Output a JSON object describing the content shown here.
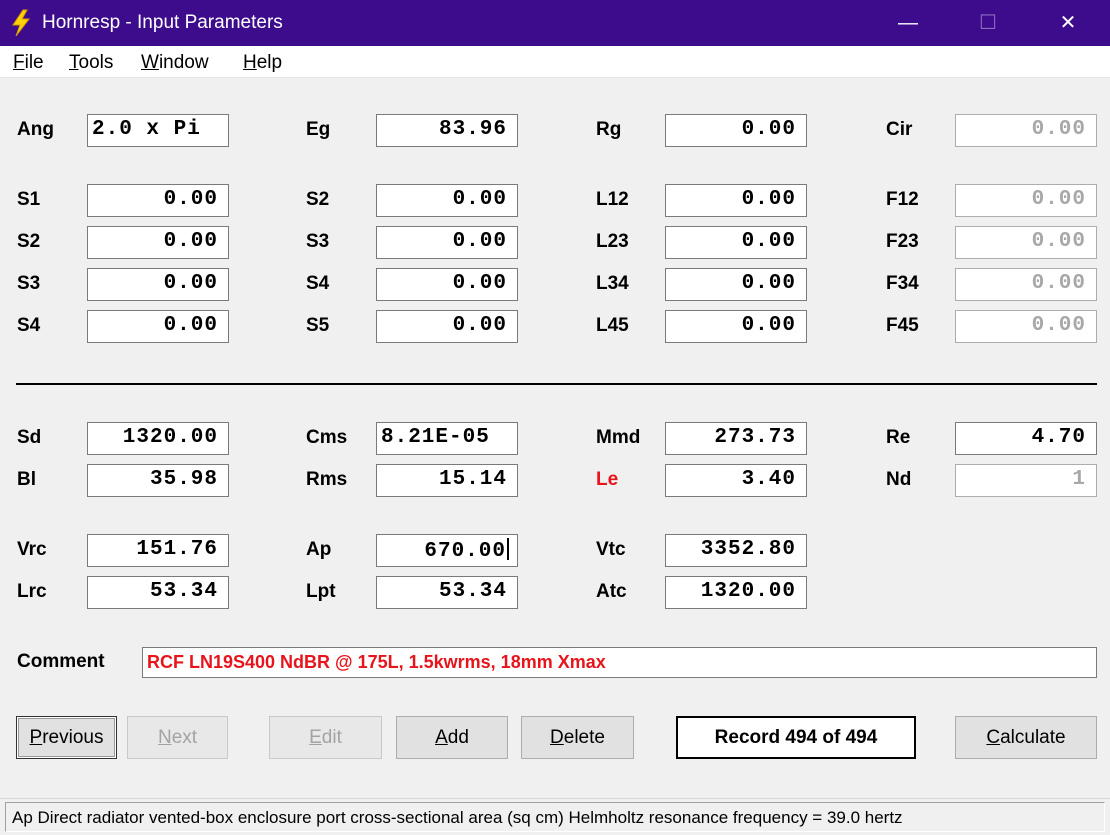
{
  "window": {
    "title": "Hornresp - Input Parameters",
    "icon": "lightning-bolt-icon",
    "controls": {
      "minimize": "—",
      "maximize": "☐",
      "close": "✕"
    }
  },
  "menu": [
    {
      "mnemonic": "F",
      "rest": "ile"
    },
    {
      "mnemonic": "T",
      "rest": "ools"
    },
    {
      "mnemonic": "W",
      "rest": "indow"
    },
    {
      "mnemonic": "H",
      "rest": "elp"
    }
  ],
  "params": {
    "ang": {
      "label": "Ang",
      "value": "2.0 x Pi"
    },
    "eg": {
      "label": "Eg",
      "value": "83.96"
    },
    "rg": {
      "label": "Rg",
      "value": "0.00"
    },
    "cir": {
      "label": "Cir",
      "value": "0.00"
    },
    "s1": {
      "label": "S1",
      "value": "0.00"
    },
    "s2a": {
      "label": "S2",
      "value": "0.00"
    },
    "l12": {
      "label": "L12",
      "value": "0.00"
    },
    "f12": {
      "label": "F12",
      "value": "0.00"
    },
    "s2b": {
      "label": "S2",
      "value": "0.00"
    },
    "s3a": {
      "label": "S3",
      "value": "0.00"
    },
    "l23": {
      "label": "L23",
      "value": "0.00"
    },
    "f23": {
      "label": "F23",
      "value": "0.00"
    },
    "s3b": {
      "label": "S3",
      "value": "0.00"
    },
    "s4a": {
      "label": "S4",
      "value": "0.00"
    },
    "l34": {
      "label": "L34",
      "value": "0.00"
    },
    "f34": {
      "label": "F34",
      "value": "0.00"
    },
    "s4b": {
      "label": "S4",
      "value": "0.00"
    },
    "s5": {
      "label": "S5",
      "value": "0.00"
    },
    "l45": {
      "label": "L45",
      "value": "0.00"
    },
    "f45": {
      "label": "F45",
      "value": "0.00"
    },
    "sd": {
      "label": "Sd",
      "value": "1320.00"
    },
    "cms": {
      "label": "Cms",
      "value": "8.21E-05"
    },
    "mmd": {
      "label": "Mmd",
      "value": "273.73"
    },
    "re": {
      "label": "Re",
      "value": "4.70"
    },
    "bl": {
      "label": "Bl",
      "value": "35.98"
    },
    "rms": {
      "label": "Rms",
      "value": "15.14"
    },
    "le": {
      "label": "Le",
      "value": "3.40"
    },
    "nd": {
      "label": "Nd",
      "value": "1"
    },
    "vrc": {
      "label": "Vrc",
      "value": "151.76"
    },
    "ap": {
      "label": "Ap",
      "value": "670.00"
    },
    "vtc": {
      "label": "Vtc",
      "value": "3352.80"
    },
    "lrc": {
      "label": "Lrc",
      "value": "53.34"
    },
    "lpt": {
      "label": "Lpt",
      "value": "53.34"
    },
    "atc": {
      "label": "Atc",
      "value": "1320.00"
    }
  },
  "comment": {
    "label": "Comment",
    "value": "RCF LN19S400 NdBR @ 175L, 1.5kwrms, 18mm Xmax"
  },
  "buttons": {
    "previous": {
      "mnemonic": "P",
      "rest": "revious"
    },
    "next": {
      "mnemonic": "N",
      "rest": "ext"
    },
    "edit": {
      "mnemonic": "E",
      "rest": "dit"
    },
    "add": {
      "mnemonic": "A",
      "rest": "dd"
    },
    "delete": {
      "mnemonic": "D",
      "rest": "elete"
    },
    "calculate": {
      "mnemonic": "C",
      "rest": "alculate"
    }
  },
  "record": "Record 494 of 494",
  "status": "Ap   Direct radiator vented-box enclosure port cross-sectional area  (sq cm)   Helmholtz resonance frequency = 39.0 hertz",
  "colors": {
    "titlebar": "#3c0c8c",
    "highlight_label": "#e8141c",
    "comment_text": "#e8141c",
    "disabled_text": "#a8a8a8"
  }
}
